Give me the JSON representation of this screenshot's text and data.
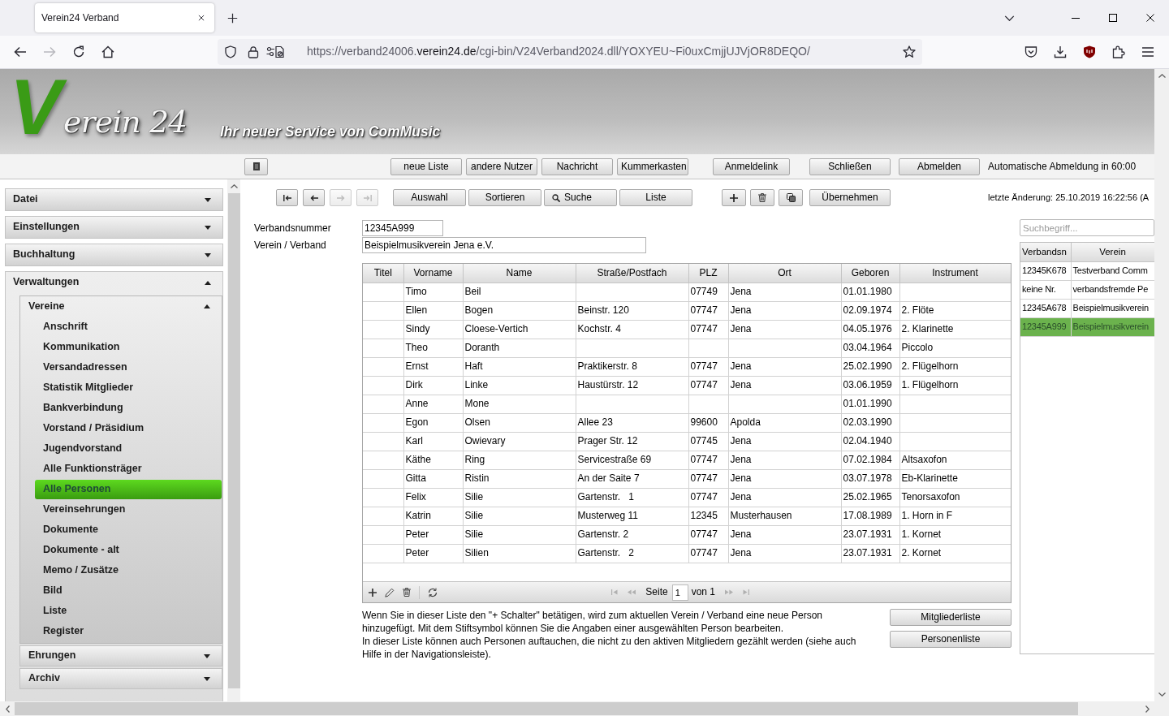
{
  "browser": {
    "tabs": [
      {
        "title": "Verein24 Verband",
        "selected": true
      }
    ],
    "nav_buttons": [
      {
        "kind": "back",
        "disabled": false
      },
      {
        "kind": "forward",
        "disabled": true
      },
      {
        "kind": "reload",
        "disabled": false
      },
      {
        "kind": "home",
        "disabled": false
      }
    ],
    "url": {
      "start": "https://verband24006.",
      "domain": "verein24.de",
      "path": "/cgi-bin/V24Verband2024.dll/YOXYEU~Fi0uxCmjjUJVjOR8DEQO/"
    }
  },
  "header": {
    "logo": {
      "initial": "V",
      "text": "erein 24"
    },
    "tagline": "Ihr neuer Service von ComMusic"
  },
  "toolbar": {
    "button_groups": [
      [
        "neue Liste",
        "andere Nutzer",
        "Nachricht",
        "Kummerkasten"
      ],
      [
        "Anmeldelink"
      ],
      [
        "Schließen",
        "Abmelden"
      ]
    ],
    "auto_logout": "Automatische Abmeldung in 60:00"
  },
  "sidebar": {
    "sections": [
      {
        "label": "Datei",
        "expanded": false
      },
      {
        "label": "Einstellungen",
        "expanded": false
      },
      {
        "label": "Buchhaltung",
        "expanded": false
      },
      {
        "label": "Verwaltungen",
        "expanded": true,
        "children": [
          {
            "label": "Vereine",
            "expanded": true,
            "children": [
              {
                "label": "Anschrift",
                "selected": false
              },
              {
                "label": "Kommunikation",
                "selected": false
              },
              {
                "label": "Versandadressen",
                "selected": false
              },
              {
                "label": "Statistik Mitglieder",
                "selected": false
              },
              {
                "label": "Bankverbindung",
                "selected": false
              },
              {
                "label": "Vorstand / Präsidium",
                "selected": false
              },
              {
                "label": "Jugendvorstand",
                "selected": false
              },
              {
                "label": "Alle Funktionsträger",
                "selected": false
              },
              {
                "label": "Alle Personen",
                "selected": true
              },
              {
                "label": "Vereinsehrungen",
                "selected": false
              },
              {
                "label": "Dokumente",
                "selected": false
              },
              {
                "label": "Dokumente - alt",
                "selected": false
              },
              {
                "label": "Memo / Zusätze",
                "selected": false
              },
              {
                "label": "Bild",
                "selected": false
              },
              {
                "label": "Liste",
                "selected": false
              },
              {
                "label": "Register",
                "selected": false
              }
            ]
          },
          {
            "label": "Ehrungen",
            "expanded": false
          },
          {
            "label": "Archiv",
            "expanded": false
          }
        ]
      }
    ]
  },
  "record_bar": {
    "nav": [
      {
        "kind": "first",
        "disabled": false
      },
      {
        "kind": "previous",
        "disabled": false
      },
      {
        "kind": "next",
        "disabled": true
      },
      {
        "kind": "last",
        "disabled": true
      }
    ],
    "actions": [
      {
        "kind": "text",
        "label": "Auswahl"
      },
      {
        "kind": "text",
        "label": "Sortieren"
      },
      {
        "kind": "search",
        "label": "Suche"
      },
      {
        "kind": "text",
        "label": "Liste"
      }
    ],
    "tools": [
      {
        "kind": "add"
      },
      {
        "kind": "delete"
      },
      {
        "kind": "copy"
      }
    ],
    "apply": "Übernehmen",
    "last_change": "letzte Änderung: 25.10.2019 16:22:56 (A"
  },
  "form": {
    "fields": [
      {
        "label": "Verbandsnummer",
        "value": "12345A999"
      },
      {
        "label": "Verein / Verband",
        "value": "Beispielmusikverein Jena e.V."
      }
    ]
  },
  "persons_table": {
    "columns": [
      "Titel",
      "Vorname",
      "Name",
      "Straße/Postfach",
      "PLZ",
      "Ort",
      "Geboren",
      "Instrument"
    ],
    "rows": [
      {
        "first_name": "Timo",
        "last_name": "Beil",
        "zip": "07749",
        "city": "Jena",
        "born": "01.01.1980"
      },
      {
        "first_name": "Ellen",
        "last_name": "Bogen",
        "street": "Beinstr. 120",
        "zip": "07747",
        "city": "Jena",
        "born": "02.09.1974",
        "instrument": "2. Flöte"
      },
      {
        "first_name": "Sindy",
        "last_name": "Cloese-Vertich",
        "street": "Kochstr. 4",
        "zip": "07747",
        "city": "Jena",
        "born": "04.05.1976",
        "instrument": "2. Klarinette"
      },
      {
        "first_name": "Theo",
        "last_name": "Doranth",
        "born": "03.04.1964",
        "instrument": "Piccolo"
      },
      {
        "first_name": "Ernst",
        "last_name": "Haft",
        "street": "Praktikerstr. 8",
        "zip": "07747",
        "city": "Jena",
        "born": "25.02.1990",
        "instrument": "2. Flügelhorn"
      },
      {
        "first_name": "Dirk",
        "last_name": "Linke",
        "street": "Haustürstr. 12",
        "zip": "07747",
        "city": "Jena",
        "born": "03.06.1959",
        "instrument": "1. Flügelhorn"
      },
      {
        "first_name": "Anne",
        "last_name": "Mone",
        "born": "01.01.1990"
      },
      {
        "first_name": "Egon",
        "last_name": "Olsen",
        "street": "Allee 23",
        "zip": "99600",
        "city": "Apolda",
        "born": "02.03.1990"
      },
      {
        "first_name": "Karl",
        "last_name": "Owievary",
        "street": "Prager Str. 12",
        "zip": "07745",
        "city": "Jena",
        "born": "02.04.1940"
      },
      {
        "first_name": "Käthe",
        "last_name": "Ring",
        "street": "Servicestraße 69",
        "zip": "07747",
        "city": "Jena",
        "born": "07.02.1984",
        "instrument": "Altsaxofon"
      },
      {
        "first_name": "Gitta",
        "last_name": "Ristin",
        "street": "An der Saite 7",
        "zip": "07747",
        "city": "Jena",
        "born": "03.07.1978",
        "instrument": "Eb-Klarinette"
      },
      {
        "first_name": "Felix",
        "last_name": "Silie",
        "street": "Gartenstr.   1",
        "zip": "07747",
        "city": "Jena",
        "born": "25.02.1965",
        "instrument": "Tenorsaxofon"
      },
      {
        "first_name": "Katrin",
        "last_name": "Silie",
        "street": "Musterweg 11",
        "zip": "12345",
        "city": "Musterhausen",
        "born": "17.08.1989",
        "instrument": "1. Horn in F"
      },
      {
        "first_name": "Peter",
        "last_name": "Silie",
        "street": "Gartenstr. 2",
        "zip": "07747",
        "city": "Jena",
        "born": "23.07.1931",
        "instrument": "1. Kornet"
      },
      {
        "first_name": "Peter",
        "last_name": "Silien",
        "street": "Gartenstr.   2",
        "zip": "07747",
        "city": "Jena",
        "born": "23.07.1931",
        "instrument": "2. Kornet"
      }
    ]
  },
  "grid_toolbar": {
    "tools": [
      {
        "kind": "add"
      },
      {
        "kind": "edit"
      },
      {
        "kind": "delete"
      },
      {
        "kind": "refresh"
      }
    ],
    "pager": {
      "nav_before": [
        {
          "kind": "first",
          "disabled": true
        },
        {
          "kind": "previous",
          "disabled": true
        }
      ],
      "page_label": "Seite",
      "page": "1",
      "page_count": "von 1",
      "nav_after": [
        {
          "kind": "next",
          "disabled": true
        },
        {
          "kind": "last",
          "disabled": true
        }
      ]
    }
  },
  "help": {
    "paragraphs": [
      "Wenn Sie in dieser Liste den \"+ Schalter\" betätigen, wird zum aktuellen Verein / Verband eine neue Person hinzugefügt. Mit dem Stiftsymbol können Sie die Angaben einer ausgewählten Person bearbeiten.",
      "In dieser Liste können auch Personen auftauchen, die nicht zu den aktiven Mitgliedern gezählt werden (siehe auch Hilfe in der Navigationsleiste)."
    ],
    "buttons": [
      "Mitgliederliste",
      "Personenliste"
    ]
  },
  "association_panel": {
    "search": {
      "placeholder": "Suchbegriff..."
    },
    "columns": [
      "Verbandsn",
      "Verein"
    ],
    "rows": [
      {
        "number": "12345K678",
        "name": "Testverband Comm",
        "selected": false
      },
      {
        "number": "keine Nr.",
        "name": "verbandsfremde Pe",
        "selected": false
      },
      {
        "number": "12345A678",
        "name": "Beispielmusikverein",
        "selected": false
      },
      {
        "number": "12345A999",
        "name": "Beispielmusikverein",
        "selected": true
      }
    ]
  }
}
